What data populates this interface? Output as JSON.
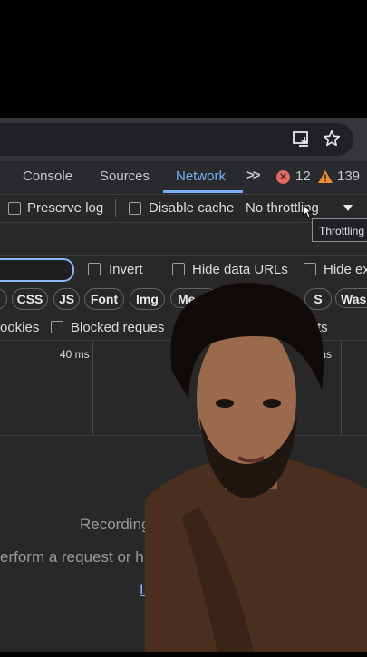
{
  "browser": {
    "download_icon": "download-icon",
    "star_icon": "star-icon"
  },
  "devtools": {
    "tabs": [
      {
        "label": "Console"
      },
      {
        "label": "Sources"
      },
      {
        "label": "Network"
      }
    ],
    "more_tabs_label": ">>",
    "errors_count": "12",
    "warnings_count": "139",
    "toolbar": {
      "preserve_log": "Preserve log",
      "disable_cache": "Disable cache",
      "throttling": "No throttling",
      "throttling_tooltip": "Throttling"
    },
    "filter_row": {
      "invert": "Invert",
      "hide_data_urls": "Hide data URLs",
      "hide_extension": "Hide ex"
    },
    "type_chips": [
      "CSS",
      "JS",
      "Font",
      "Img",
      "Me",
      "S",
      "Wasm"
    ],
    "cookie_row": {
      "cookies": "ookies",
      "blocked_requests": "Blocked reques",
      "third_party": "ts"
    },
    "timeline": {
      "label_1": "40 ms",
      "label_2": "0 ms"
    },
    "empty_state": {
      "line_1": "Recording",
      "line_2": "erform a request or h",
      "link": "L"
    }
  },
  "colors": {
    "accent": "#7cacf8",
    "error": "#e46962",
    "warning": "#f28b2c"
  }
}
